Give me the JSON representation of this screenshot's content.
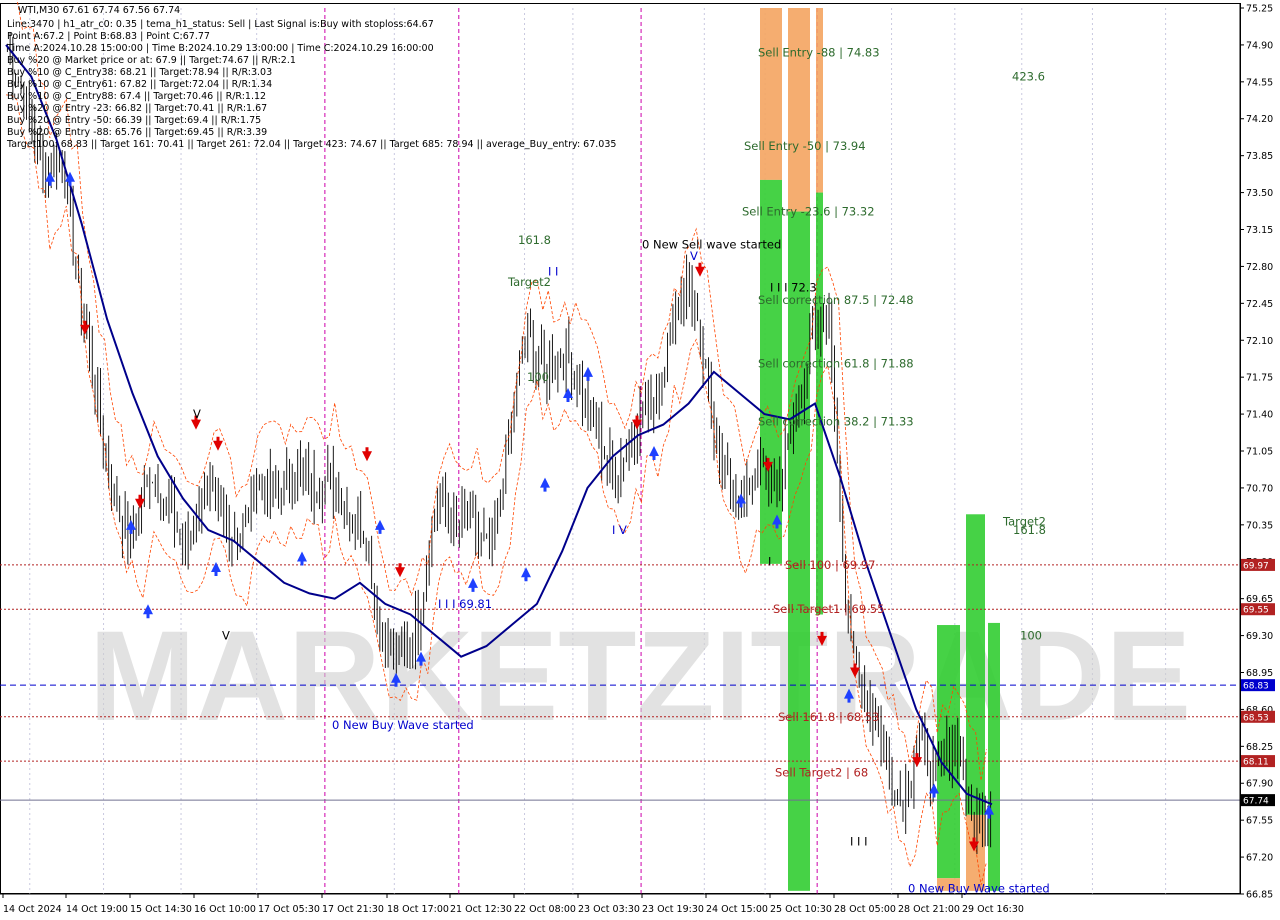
{
  "info": {
    "symbol_line": "WTI,M30  67.61 67.74 67.56 67.74",
    "lines": [
      "Line:3470 | h1_atr_c0: 0.35 | tema_h1_status: Sell | Last Signal is:Buy with stoploss:64.67",
      "Point A:67.2 | Point B:68.83 | Point C:67.77",
      "Time A:2024.10.28 15:00:00 | Time B:2024.10.29 13:00:00 | Time C:2024.10.29 16:00:00",
      "Buy %20 @ Market price or at: 67.9 || Target:74.67 || R/R:2.1",
      "Buy %10 @ C_Entry38: 68.21 || Target:78.94 || R/R:3.03",
      "Buy %10 @ C_Entry61: 67.82 || Target:72.04 || R/R:1.34",
      "Buy %10 @ C_Entry88: 67.4 || Target:70.46 || R/R:1.12",
      "Buy %20 @ Entry -23: 66.82 || Target:70.41 || R/R:1.67",
      "Buy %20 @ Entry -50: 66.39 || Target:69.4 || R/R:1.75",
      "Buy %20 @ Entry -88: 65.76 || Target:69.45 || R/R:3.39",
      "Target100: 68.83 || Target 161: 70.41 || Target 261: 72.04 || Target 423: 74.67 || Target 685: 78.94 || average_Buy_entry: 67.035"
    ]
  },
  "watermark": "MARKETZITRADE",
  "colors": {
    "background": "#ffffff",
    "candle": "#000000",
    "ma_line": "#00008b",
    "envelope": "#ff4500",
    "green_zone": "#32cd32",
    "orange_zone": "#f4a460",
    "red_level": "#b22222",
    "blue_level": "#0000cd",
    "current_price_tag": "#000000",
    "sell_arrow": "#e00000",
    "buy_arrow": "#1e40ff",
    "annotation_green": "#2e6b2e",
    "annotation_red": "#b22222",
    "annotation_blue": "#0000cd"
  },
  "chart_data": {
    "type": "candlestick",
    "instrument": "WTI",
    "timeframe": "M30",
    "ylim": [
      66.85,
      75.25
    ],
    "y_ticks": [
      "75.25",
      "74.90",
      "74.55",
      "74.20",
      "73.85",
      "73.50",
      "73.15",
      "72.80",
      "72.45",
      "72.10",
      "71.75",
      "71.40",
      "71.05",
      "70.70",
      "70.35",
      "70.00",
      "69.65",
      "69.30",
      "68.95",
      "68.60",
      "68.25",
      "67.90",
      "67.55",
      "67.20",
      "66.85"
    ],
    "x_ticks": [
      "14 Oct 2024",
      "14 Oct 19:00",
      "15 Oct 14:30",
      "16 Oct 10:00",
      "17 Oct 05:30",
      "17 Oct 21:30",
      "18 Oct 17:00",
      "21 Oct 12:30",
      "22 Oct 08:00",
      "23 Oct 03:30",
      "23 Oct 19:30",
      "24 Oct 15:00",
      "25 Oct 10:30",
      "28 Oct 05:00",
      "28 Oct 21:00",
      "29 Oct 16:30"
    ],
    "close_path": [
      74.9,
      74.4,
      73.7,
      73.9,
      72.6,
      71.5,
      70.6,
      70.2,
      70.9,
      70.5,
      70.1,
      70.7,
      70.4,
      70.2,
      70.8,
      70.6,
      70.9,
      70.7,
      70.8,
      70.5,
      70.3,
      69.2,
      69.1,
      69.5,
      70.6,
      70.3,
      70.4,
      70.0,
      71.1,
      72.2,
      71.8,
      72.0,
      71.7,
      71.2,
      70.8,
      71.3,
      71.5,
      72.1,
      72.7,
      71.8,
      70.9,
      70.5,
      70.9,
      70.7,
      71.3,
      72.1,
      72.3,
      69.3,
      68.8,
      68.2,
      67.7,
      68.3,
      67.9,
      68.4,
      67.5,
      67.7
    ],
    "ma_path": [
      74.9,
      74.6,
      74.0,
      73.2,
      72.3,
      71.6,
      71.0,
      70.6,
      70.3,
      70.2,
      70.0,
      69.8,
      69.7,
      69.65,
      69.8,
      69.6,
      69.5,
      69.3,
      69.1,
      69.2,
      69.4,
      69.6,
      70.1,
      70.7,
      71.0,
      71.2,
      71.3,
      71.5,
      71.8,
      71.6,
      71.4,
      71.35,
      71.5,
      70.8,
      70.0,
      69.3,
      68.6,
      68.1,
      67.8,
      67.7
    ],
    "levels": [
      {
        "label": "69.97",
        "price": 69.97,
        "style": "red-dotted"
      },
      {
        "label": "69.55",
        "price": 69.55,
        "style": "red-dotted"
      },
      {
        "label": "68.83",
        "price": 68.83,
        "style": "blue-dashed"
      },
      {
        "label": "68.53",
        "price": 68.53,
        "style": "red-dotted"
      },
      {
        "label": "68.11",
        "price": 68.11,
        "style": "red-dotted"
      },
      {
        "label": "67.74",
        "price": 67.74,
        "style": "current"
      }
    ],
    "annotations": [
      {
        "text": "Sell Entry -88 | 74.83",
        "price": 74.83,
        "color": "green"
      },
      {
        "text": "Sell Entry -50 | 73.94",
        "price": 73.94,
        "color": "green"
      },
      {
        "text": "Sell Entry -23.6 | 73.32",
        "price": 73.32,
        "color": "green"
      },
      {
        "text": "0 New Sell wave started",
        "price": 73.01,
        "color": "black"
      },
      {
        "text": "I I I 72.3",
        "price": 72.6,
        "color": "black"
      },
      {
        "text": "Sell correction 87.5 | 72.48",
        "price": 72.48,
        "color": "green"
      },
      {
        "text": "Sell correction 61.8 | 71.88",
        "price": 71.88,
        "color": "green"
      },
      {
        "text": "Sell correction 38.2 | 71.33",
        "price": 71.33,
        "color": "green"
      },
      {
        "text": "Sell 100 | 69.97",
        "price": 69.97,
        "color": "red"
      },
      {
        "text": "Sell Target1 | 69.55",
        "price": 69.55,
        "color": "red"
      },
      {
        "text": "Sell 161.8 | 68.53",
        "price": 68.53,
        "color": "red"
      },
      {
        "text": "Sell Target2 | 68",
        "price": 68.0,
        "color": "red"
      },
      {
        "text": "I I I 69.81",
        "price": 69.6,
        "color": "blue"
      },
      {
        "text": "0 New Buy Wave started",
        "price": 68.45,
        "color": "blue"
      },
      {
        "text": "0 New Buy Wave started",
        "price": 66.9,
        "color": "blue"
      },
      {
        "text": "161.8",
        "price": 73.05,
        "color": "green"
      },
      {
        "text": "Target2",
        "price": 72.65,
        "color": "green"
      },
      {
        "text": "100",
        "price": 71.75,
        "color": "green"
      },
      {
        "text": "423.6",
        "price": 74.6,
        "color": "green"
      },
      {
        "text": "Target2",
        "price": 70.38,
        "color": "green"
      },
      {
        "text": "161.8",
        "price": 70.3,
        "color": "green"
      },
      {
        "text": "100",
        "price": 69.3,
        "color": "green"
      },
      {
        "text": "I V",
        "price": 70.3,
        "color": "blue"
      },
      {
        "text": "V",
        "price": 71.4,
        "color": "black"
      },
      {
        "text": "V",
        "price": 69.3,
        "color": "black"
      },
      {
        "text": "V",
        "price": 72.9,
        "color": "blue"
      },
      {
        "text": "I I I",
        "price": 67.35,
        "color": "black"
      },
      {
        "text": "I I",
        "price": 72.75,
        "color": "blue"
      },
      {
        "text": "I",
        "price": 70.0,
        "color": "black"
      }
    ]
  }
}
